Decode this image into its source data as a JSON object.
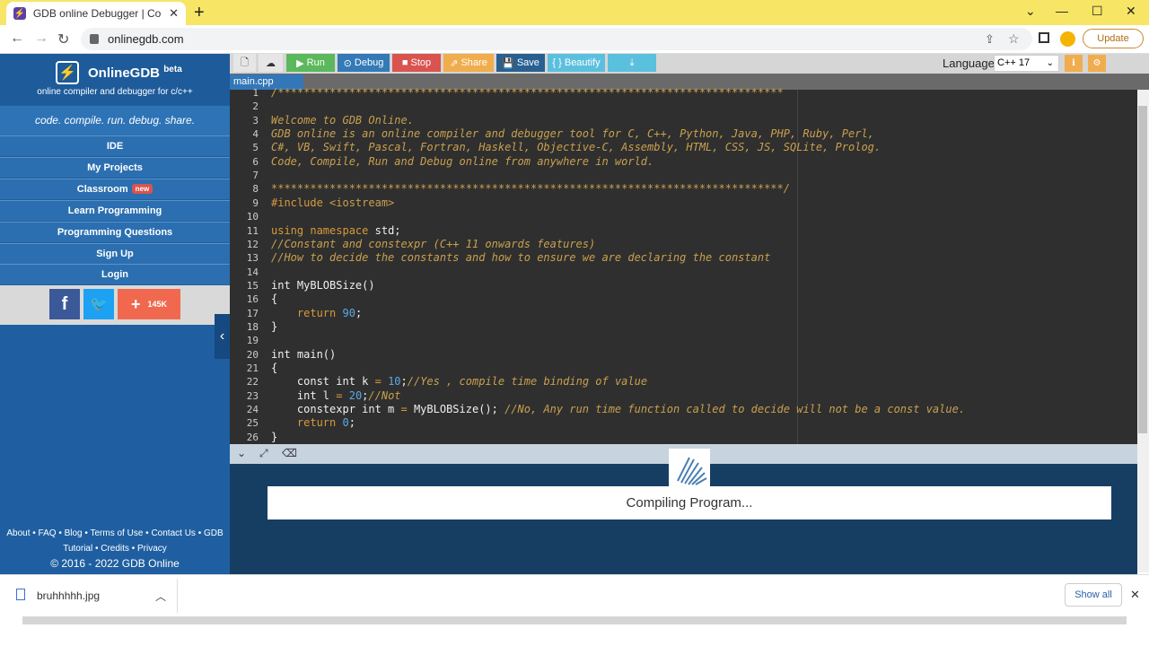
{
  "browser": {
    "tab_title": "GDB online Debugger | Compiler",
    "tab_close": "✕",
    "new_tab": "+",
    "url": "onlinegdb.com",
    "update_label": "Update",
    "minimize": "⌄",
    "restore": "—",
    "maximize": "☐",
    "close": "✕"
  },
  "sidebar": {
    "brand": "OnlineGDB",
    "brand_sup": "beta",
    "brand_sub": "online compiler and debugger for c/c++",
    "tagline": "code. compile. run. debug. share.",
    "items": [
      {
        "label": "IDE"
      },
      {
        "label": "My Projects"
      },
      {
        "label": "Classroom",
        "badge": "new"
      },
      {
        "label": "Learn Programming"
      },
      {
        "label": "Programming Questions"
      },
      {
        "label": "Sign Up"
      },
      {
        "label": "Login"
      }
    ],
    "social_count": "145K",
    "footer_line1": "About • FAQ • Blog • Terms of Use • Contact Us • GDB",
    "footer_line2": "Tutorial • Credits • Privacy",
    "copyright": "© 2016 - 2022 GDB Online"
  },
  "toolbar": {
    "run": "Run",
    "debug": "Debug",
    "stop": "Stop",
    "share": "Share",
    "save": "Save",
    "beautify": "{ } Beautify",
    "language_label": "Language",
    "language_value": "C++ 17"
  },
  "file_tab": "main.cpp",
  "code_lines": [
    "/******************************************************************************",
    "",
    "Welcome to GDB Online.",
    "GDB online is an online compiler and debugger tool for C, C++, Python, Java, PHP, Ruby, Perl,",
    "C#, VB, Swift, Pascal, Fortran, Haskell, Objective-C, Assembly, HTML, CSS, JS, SQLite, Prolog.",
    "Code, Compile, Run and Debug online from anywhere in world.",
    "",
    "*******************************************************************************/",
    "#include <iostream>",
    "",
    "using namespace std;",
    "//Constant and constexpr (C++ 11 onwards features)",
    "//How to decide the constants and how to ensure we are declaring the constant",
    "",
    "int MyBLOBSize()",
    "{",
    "    return 90;",
    "}",
    "",
    "int main()",
    "{",
    "    const int k = 10;//Yes , compile time binding of value",
    "    int l = 20;//Not",
    "    constexpr int m = MyBLOBSize(); //No, Any run time function called to decide will not be a const value.",
    "    return 0;",
    "}"
  ],
  "output": {
    "status": "Compiling Program..."
  },
  "downloads": {
    "file": "bruhhhhh.jpg",
    "show_all": "Show all"
  },
  "colors": {
    "sidebar_bg": "#1f5fa1",
    "editor_bg": "#2f2f2f",
    "run_green": "#5cb85c",
    "debug_blue": "#337ab7",
    "stop_red": "#d9534f",
    "share_orange": "#f0ad4e",
    "save_blue": "#286090",
    "beautify_blue": "#5bc0de",
    "tabbar_yellow": "#f7e565"
  }
}
